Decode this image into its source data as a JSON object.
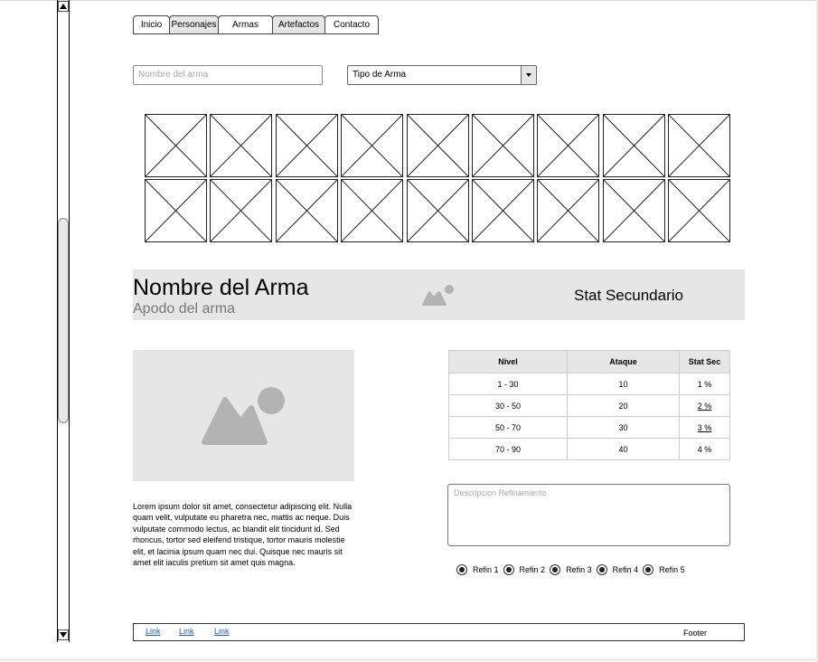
{
  "nav": {
    "tabs": [
      {
        "label": "Inicio"
      },
      {
        "label": "Personajes"
      },
      {
        "label": "Armas"
      },
      {
        "label": "Artefactos"
      },
      {
        "label": "Contacto"
      }
    ]
  },
  "filters": {
    "name_placeholder": "Nombre del arma",
    "type_select_value": "Tipo de Arma"
  },
  "weapon": {
    "name": "Nombre del Arma",
    "nickname": "Apodo del arma",
    "secondary_stat": "Stat Secundario",
    "description": "Lorem ipsum dolor sit amet, consectetur adipiscing elit. Nulla quam velit, vulputate eu pharetra nec, mattis ac neque. Duis vulputate commodo lectus, ac blandit elit tincidunt id. Sed rhoncus, tortor sed eleifend tristique, tortor mauris molestie elit, et lacinia ipsum quam nec dui. Quisque nec mauris sit amet elit iaculis pretium sit amet quis magna."
  },
  "stats_table": {
    "headers": [
      "Nivel",
      "Ataque",
      "Stat Sec"
    ],
    "rows": [
      [
        "1 - 30",
        "10",
        "1 %"
      ],
      [
        "30 - 50",
        "20",
        "2 %"
      ],
      [
        "50 - 70",
        "30",
        "3 %"
      ],
      [
        "70 - 90",
        "40",
        "4 %"
      ]
    ]
  },
  "refinement": {
    "placeholder": "Descripcion Refinamiento",
    "options": [
      "Refin 1",
      "Refin 2",
      "Refin 3",
      "Refin 4",
      "Refin 5"
    ]
  },
  "footer": {
    "links": [
      "Link",
      "Link",
      "Link"
    ],
    "text": "Footer"
  }
}
